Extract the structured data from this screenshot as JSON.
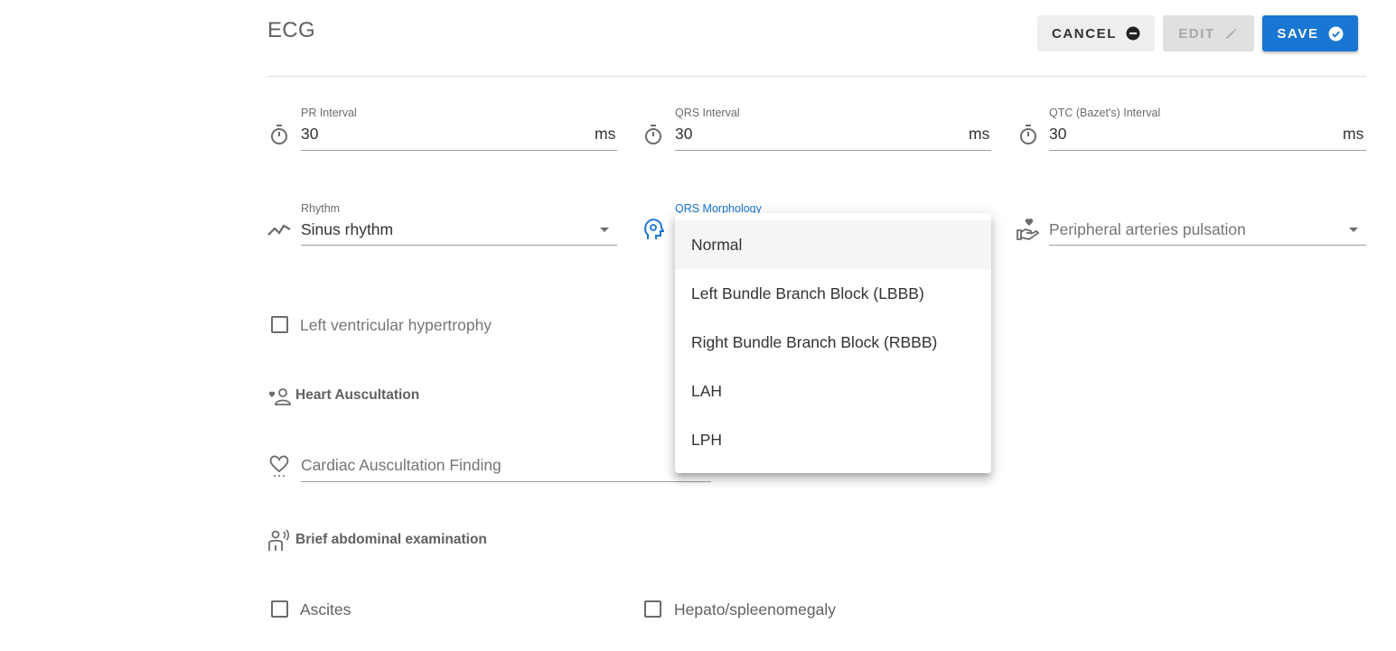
{
  "header": {
    "title": "ECG",
    "cancel_label": "CANCEL",
    "edit_label": "EDIT",
    "save_label": "SAVE"
  },
  "intervals": [
    {
      "label": "PR Interval",
      "value": "30",
      "unit": "ms"
    },
    {
      "label": "QRS Interval",
      "value": "30",
      "unit": "ms"
    },
    {
      "label": "QTC (Bazet's) Interval",
      "value": "30",
      "unit": "ms"
    }
  ],
  "rhythm": {
    "label": "Rhythm",
    "value": "Sinus rhythm"
  },
  "qrs_morphology": {
    "label": "QRS Morphology",
    "options": [
      "Normal",
      "Left Bundle Branch Block (LBBB)",
      "Right Bundle Branch Block (RBBB)",
      "LAH",
      "LPH"
    ],
    "highlighted": "Normal"
  },
  "peripheral": {
    "placeholder": "Peripheral arteries pulsation"
  },
  "lvh": {
    "label": "Left ventricular hypertrophy",
    "checked": false
  },
  "heart_auscultation": {
    "title": "Heart Auscultation",
    "finding_placeholder": "Cardiac Auscultation Finding"
  },
  "abdominal": {
    "title": "Brief abdominal examination",
    "ascites_label": "Ascites",
    "hepato_label": "Hepato/spleenomegaly"
  },
  "colors": {
    "accent": "#1976d2",
    "text": "#333333",
    "muted": "#757575"
  },
  "icons": [
    "timer-icon",
    "trending-icon",
    "head-gear-icon",
    "hand-heart-icon",
    "heart-person-icon",
    "heart-outline-icon",
    "person-sound-icon",
    "minus-circle-icon",
    "pencil-icon",
    "check-circle-icon",
    "caret-down-icon"
  ]
}
